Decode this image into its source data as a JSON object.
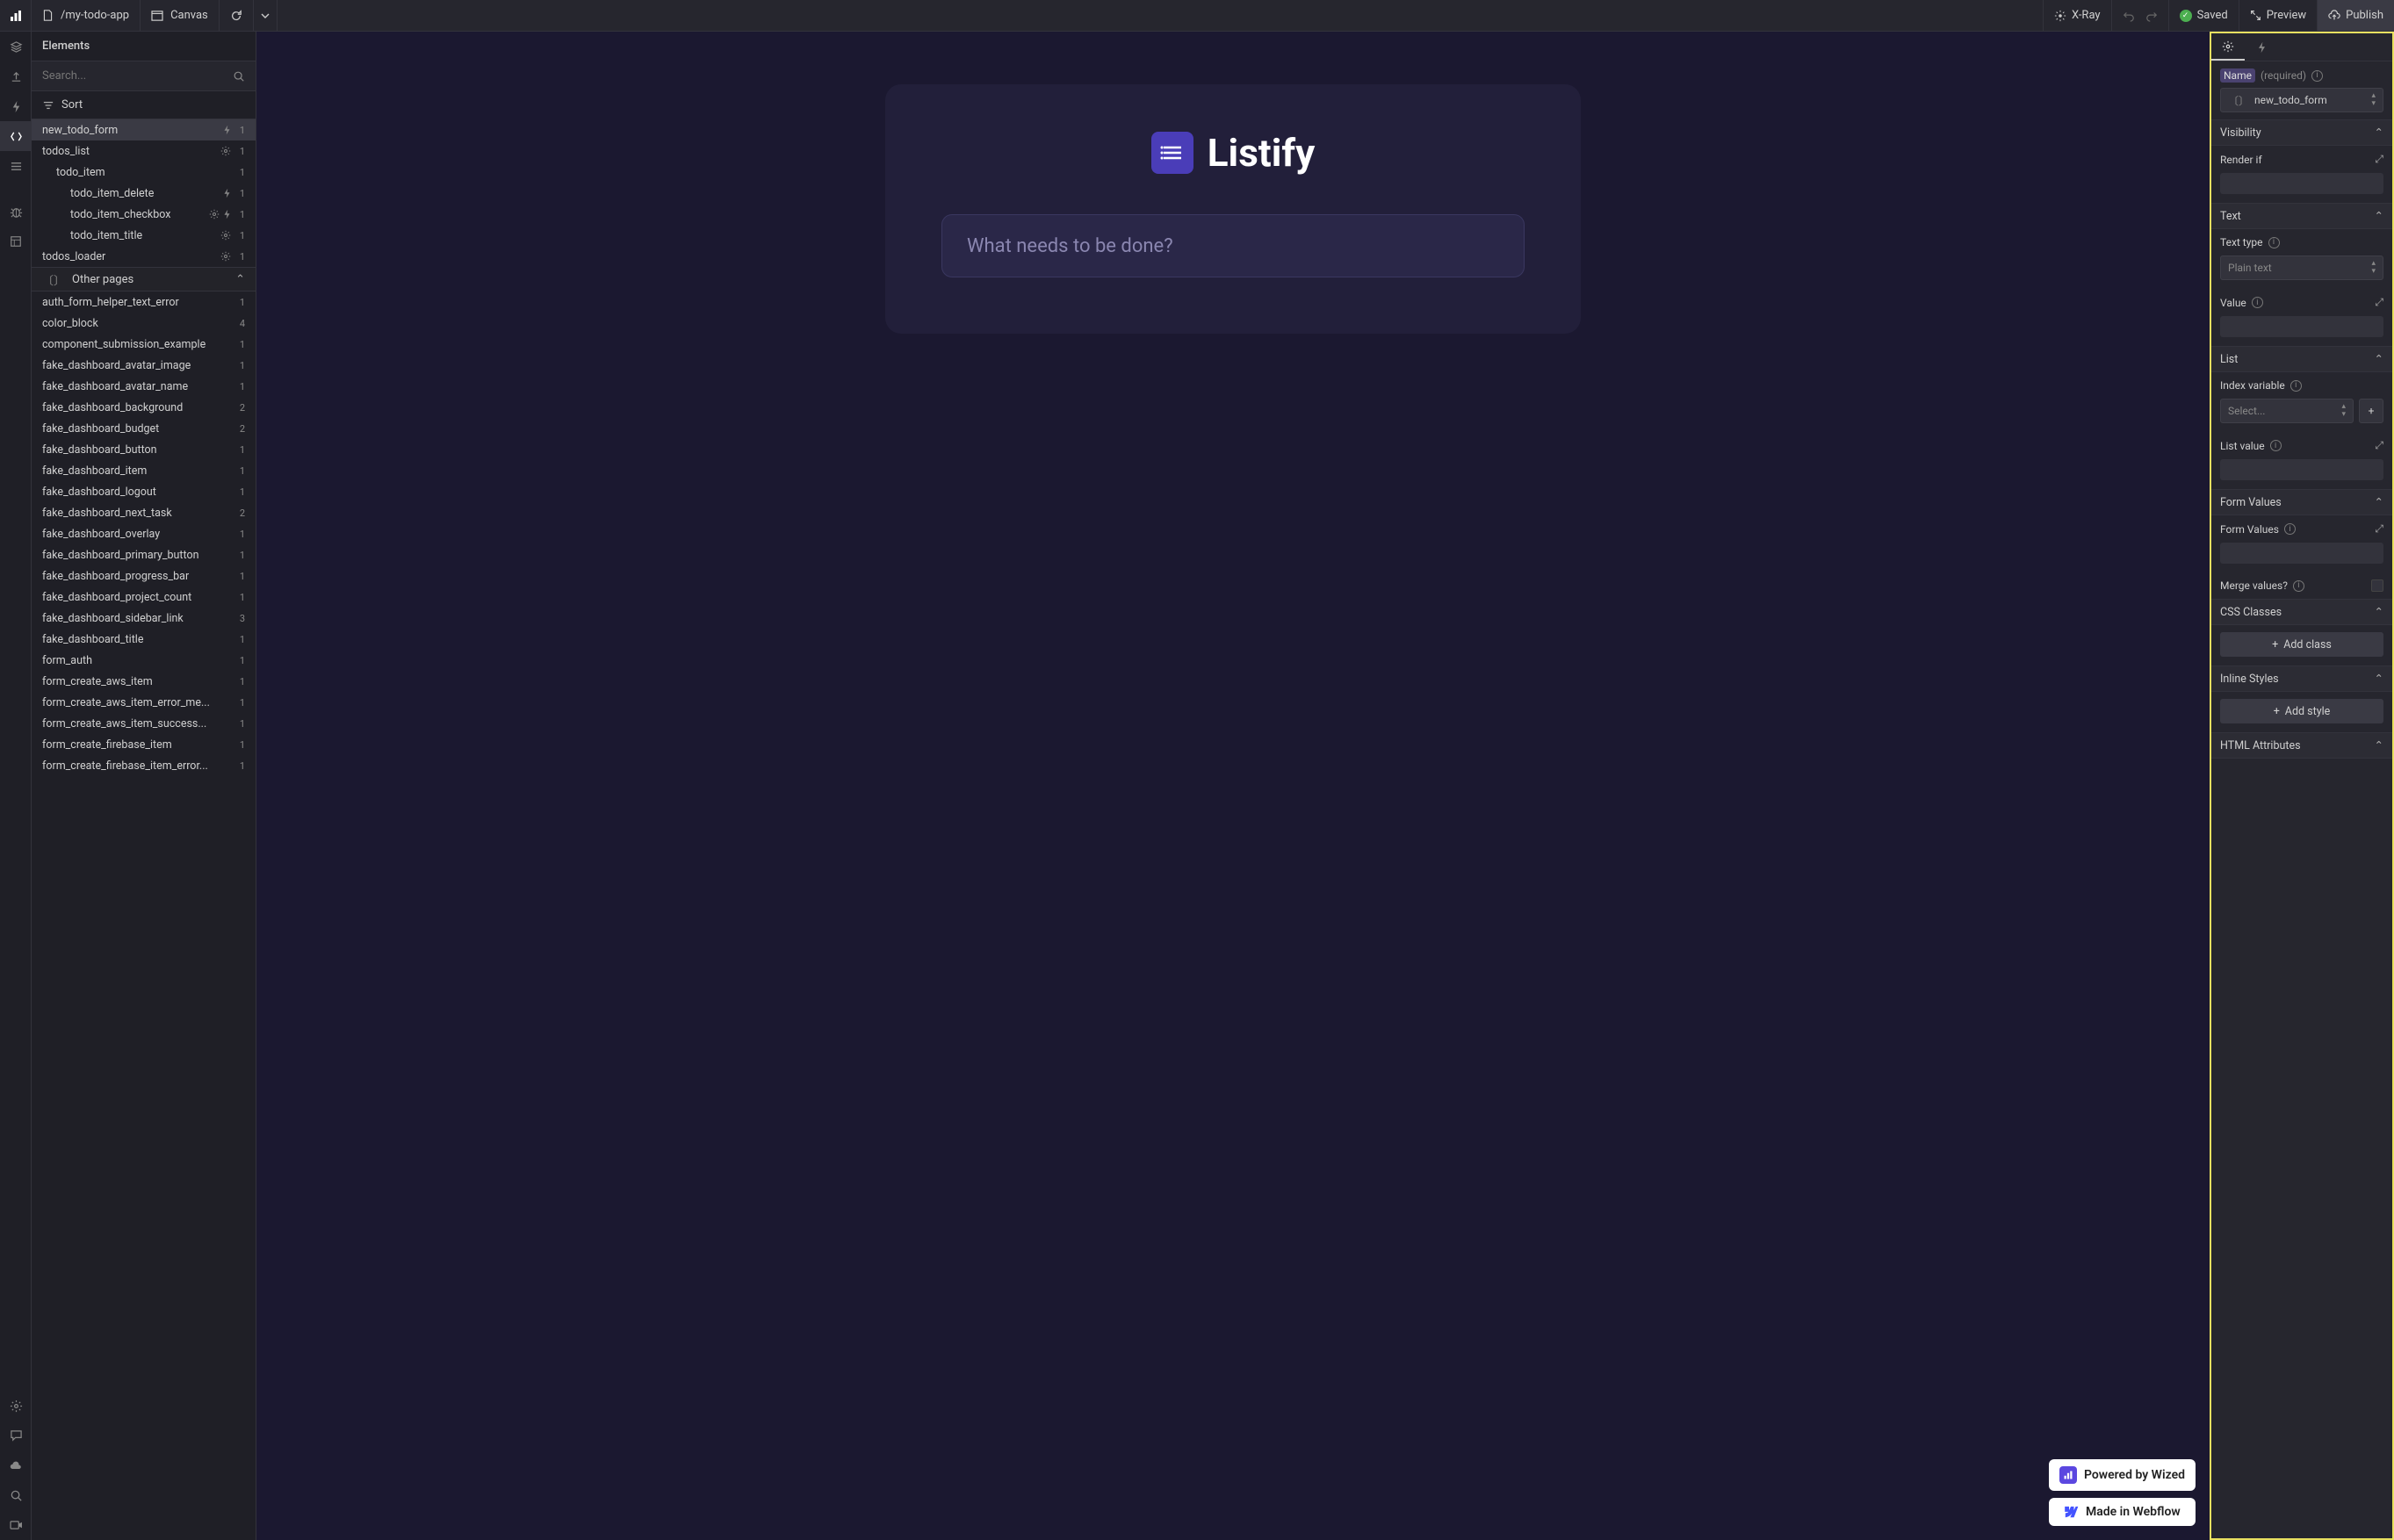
{
  "topbar": {
    "project_path": "/my-todo-app",
    "canvas_label": "Canvas",
    "xray_label": "X-Ray",
    "saved_label": "Saved",
    "preview_label": "Preview",
    "publish_label": "Publish"
  },
  "elements_panel": {
    "title": "Elements",
    "search_placeholder": "Search...",
    "sort_label": "Sort",
    "other_pages_label": "Other pages",
    "tree": [
      {
        "label": "new_todo_form",
        "indent": 0,
        "count": 1,
        "icons": [
          "bolt"
        ],
        "selected": true
      },
      {
        "label": "todos_list",
        "indent": 0,
        "count": 1,
        "icons": [
          "gear"
        ]
      },
      {
        "label": "todo_item",
        "indent": 1,
        "count": 1,
        "icons": []
      },
      {
        "label": "todo_item_delete",
        "indent": 2,
        "count": 1,
        "icons": [
          "bolt"
        ]
      },
      {
        "label": "todo_item_checkbox",
        "indent": 2,
        "count": 1,
        "icons": [
          "gear",
          "bolt"
        ]
      },
      {
        "label": "todo_item_title",
        "indent": 2,
        "count": 1,
        "icons": [
          "gear"
        ]
      },
      {
        "label": "todos_loader",
        "indent": 0,
        "count": 1,
        "icons": [
          "gear"
        ]
      }
    ],
    "other_pages": [
      {
        "label": "auth_form_helper_text_error",
        "count": 1
      },
      {
        "label": "color_block",
        "count": 4
      },
      {
        "label": "component_submission_example",
        "count": 1
      },
      {
        "label": "fake_dashboard_avatar_image",
        "count": 1
      },
      {
        "label": "fake_dashboard_avatar_name",
        "count": 1
      },
      {
        "label": "fake_dashboard_background",
        "count": 2
      },
      {
        "label": "fake_dashboard_budget",
        "count": 2
      },
      {
        "label": "fake_dashboard_button",
        "count": 1
      },
      {
        "label": "fake_dashboard_item",
        "count": 1
      },
      {
        "label": "fake_dashboard_logout",
        "count": 1
      },
      {
        "label": "fake_dashboard_next_task",
        "count": 2
      },
      {
        "label": "fake_dashboard_overlay",
        "count": 1
      },
      {
        "label": "fake_dashboard_primary_button",
        "count": 1
      },
      {
        "label": "fake_dashboard_progress_bar",
        "count": 1
      },
      {
        "label": "fake_dashboard_project_count",
        "count": 1
      },
      {
        "label": "fake_dashboard_sidebar_link",
        "count": 3
      },
      {
        "label": "fake_dashboard_title",
        "count": 1
      },
      {
        "label": "form_auth",
        "count": 1
      },
      {
        "label": "form_create_aws_item",
        "count": 1
      },
      {
        "label": "form_create_aws_item_error_me...",
        "count": 1
      },
      {
        "label": "form_create_aws_item_success...",
        "count": 1
      },
      {
        "label": "form_create_firebase_item",
        "count": 1
      },
      {
        "label": "form_create_firebase_item_error...",
        "count": 1
      }
    ]
  },
  "canvas": {
    "app_title": "Listify",
    "input_placeholder": "What needs to be done?",
    "badge_wized": "Powered by Wized",
    "badge_webflow": "Made in Webflow"
  },
  "inspector": {
    "name_label": "Name",
    "name_required": "(required)",
    "name_value": "new_todo_form",
    "sections": {
      "visibility": "Visibility",
      "render_if": "Render if",
      "text": "Text",
      "text_type": "Text type",
      "text_type_value": "Plain text",
      "value": "Value",
      "list": "List",
      "index_variable": "Index variable",
      "index_select": "Select...",
      "list_value": "List value",
      "form_values": "Form Values",
      "form_values_label": "Form Values",
      "merge_values": "Merge values?",
      "css_classes": "CSS Classes",
      "add_class": "Add class",
      "inline_styles": "Inline Styles",
      "add_style": "Add style",
      "html_attributes": "HTML Attributes"
    }
  }
}
